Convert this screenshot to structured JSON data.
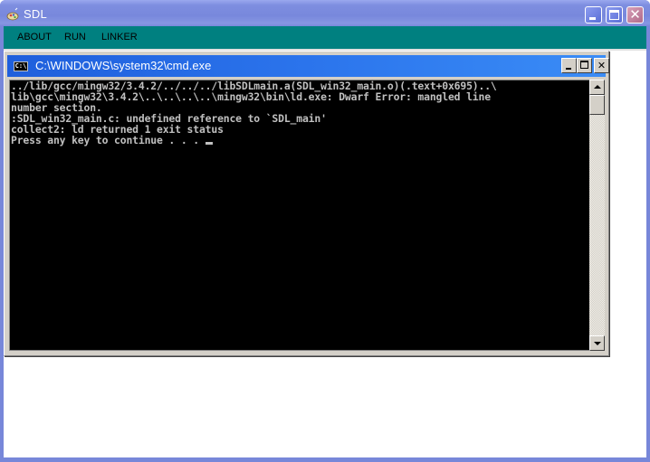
{
  "outer_window": {
    "title": "SDL",
    "app_icon": "sdl-app-icon",
    "controls": [
      "minimize",
      "maximize",
      "close"
    ],
    "colors": {
      "titlebar": "#7888dc",
      "menubar": "#008080",
      "client": "#ffffff"
    }
  },
  "menubar": {
    "items": [
      {
        "label": "ABOUT"
      },
      {
        "label": "RUN"
      },
      {
        "label": "LINKER"
      }
    ]
  },
  "cmd_window": {
    "title": "C:\\WINDOWS\\system32\\cmd.exe",
    "icon_label": "C:\\",
    "controls": {
      "close_glyph": "✕"
    },
    "colors": {
      "titlebar": "#2b74ec",
      "background": "#000000",
      "text": "#c0c0c0"
    },
    "console_lines": [
      "../lib/gcc/mingw32/3.4.2/../../../libSDLmain.a(SDL_win32_main.o)(.text+0x695)..\\",
      "lib\\gcc\\mingw32\\3.4.2\\..\\..\\..\\..\\mingw32\\bin\\ld.exe: Dwarf Error: mangled line",
      "number section.",
      ":SDL_win32_main.c: undefined reference to `SDL_main'",
      "collect2: ld returned 1 exit status",
      "Press any key to continue . . . "
    ]
  }
}
